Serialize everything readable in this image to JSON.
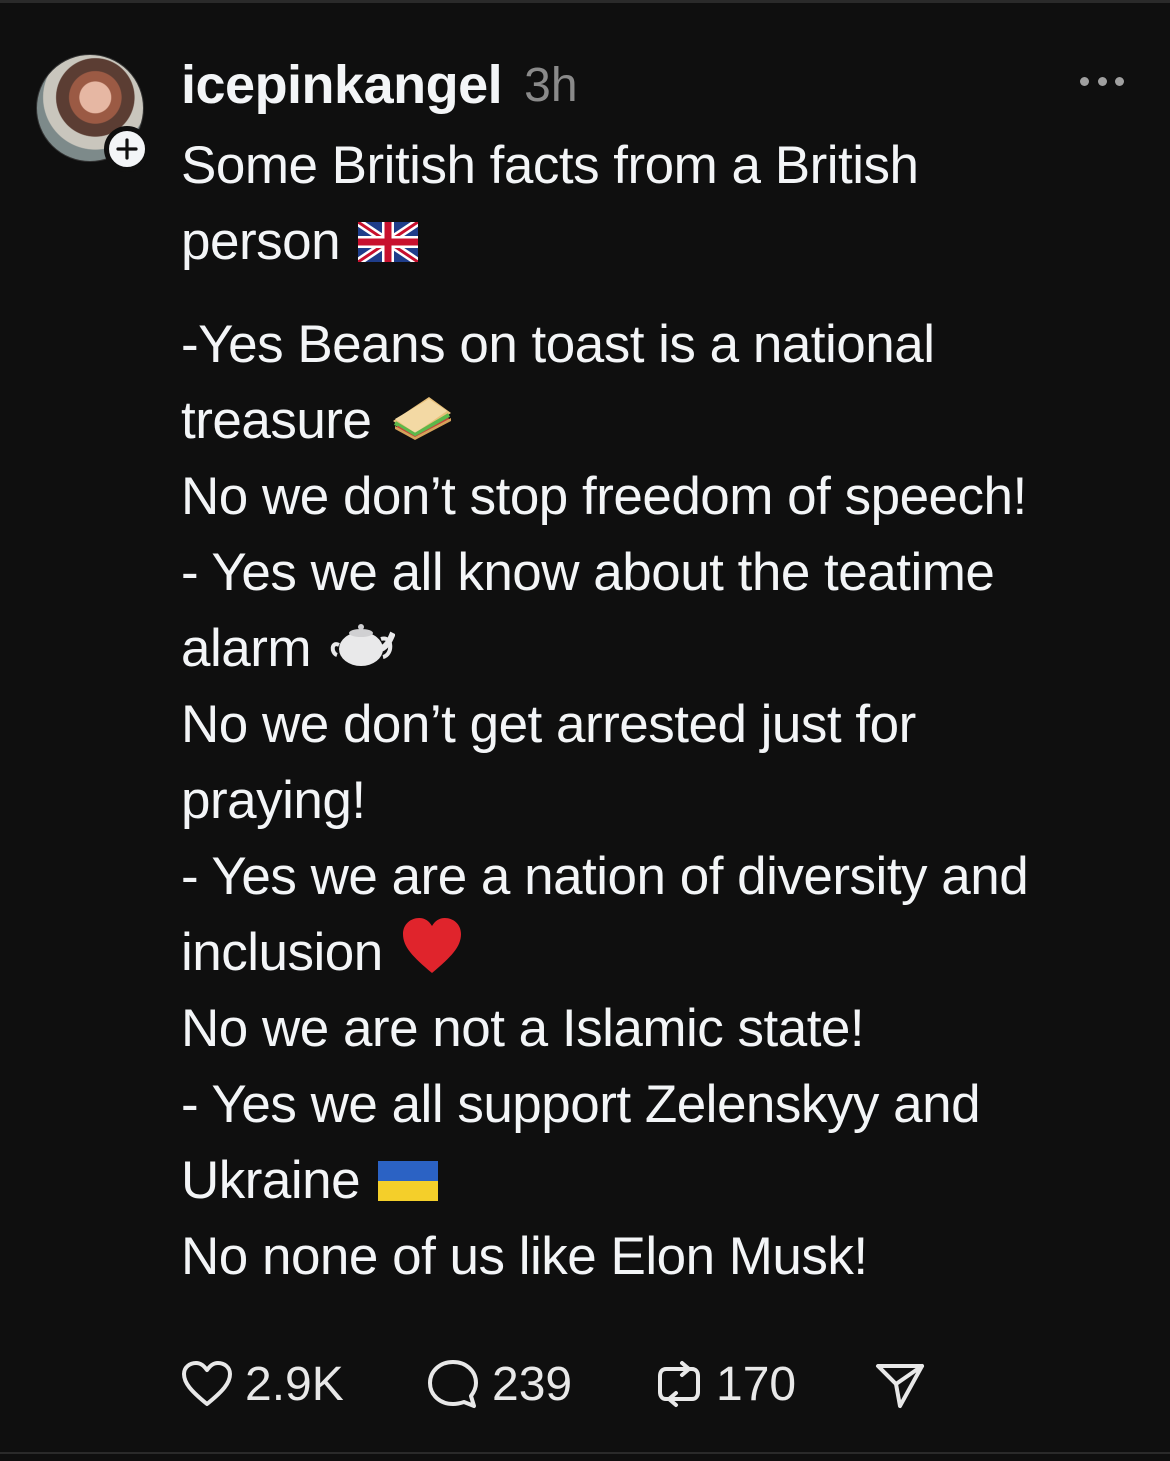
{
  "post": {
    "username": "icepinkangel",
    "timestamp": "3h",
    "lines": [
      "Some British facts from a British",
      "person",
      "-Yes Beans on toast is a national",
      "treasure",
      "No we don’t stop freedom of speech!",
      "- Yes we all know about the teatime",
      "alarm",
      "No we don’t get arrested just for",
      "praying!",
      "- Yes we are a nation of diversity and",
      "inclusion",
      "No we are not a Islamic state!",
      "- Yes we all support Zelenskyy and",
      "Ukraine",
      "No none of us like Elon Musk!"
    ],
    "emojis": {
      "uk_flag": "uk-flag-icon",
      "sandwich": "sandwich-icon",
      "teapot": "teapot-icon",
      "heart": "red-heart-icon",
      "ukraine_flag": "ukraine-flag-icon"
    }
  },
  "actions": {
    "likes": "2.9K",
    "replies": "239",
    "reposts": "170"
  },
  "colors": {
    "background": "#0f0f0f",
    "text": "#f3f5f7",
    "muted": "#8a8a8a"
  }
}
